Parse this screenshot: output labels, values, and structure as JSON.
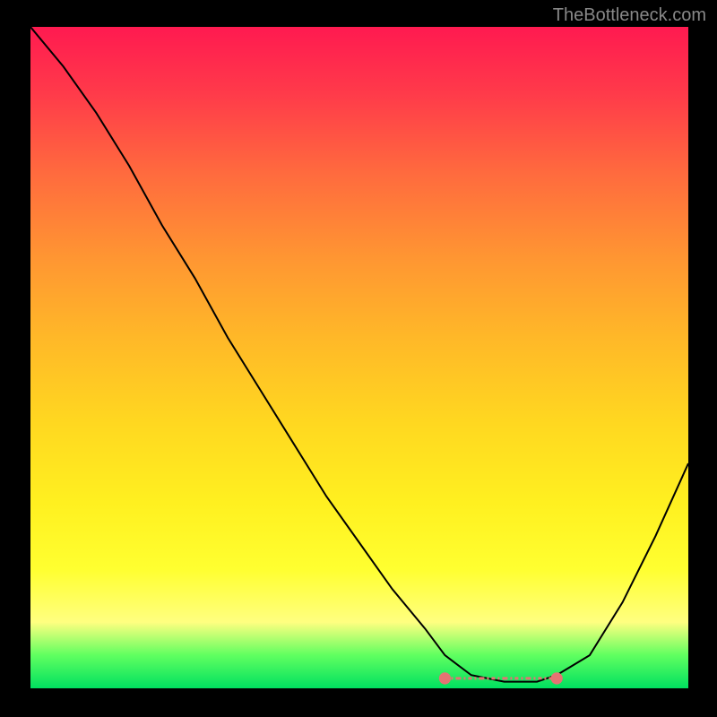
{
  "watermark": "TheBottleneck.com",
  "chart_data": {
    "type": "line",
    "title": "",
    "xlabel": "",
    "ylabel": "",
    "xlim": [
      0,
      100
    ],
    "ylim": [
      0,
      100
    ],
    "series": [
      {
        "name": "bottleneck-curve",
        "x": [
          0,
          5,
          10,
          15,
          20,
          25,
          30,
          35,
          40,
          45,
          50,
          55,
          60,
          63,
          67,
          72,
          77,
          80,
          85,
          90,
          95,
          100
        ],
        "values": [
          100,
          94,
          87,
          79,
          70,
          62,
          53,
          45,
          37,
          29,
          22,
          15,
          9,
          5,
          2,
          1,
          1,
          2,
          5,
          13,
          23,
          34
        ]
      }
    ],
    "highlight_range": {
      "name": "optimal-zone",
      "x_start": 63,
      "x_end": 80,
      "y": 1.5,
      "color": "#e57373"
    },
    "gradient_stops": [
      {
        "pos": 0,
        "color": "#ff1a50"
      },
      {
        "pos": 35,
        "color": "#ff9632"
      },
      {
        "pos": 72,
        "color": "#fff020"
      },
      {
        "pos": 95,
        "color": "#60ff60"
      },
      {
        "pos": 100,
        "color": "#00e060"
      }
    ]
  }
}
